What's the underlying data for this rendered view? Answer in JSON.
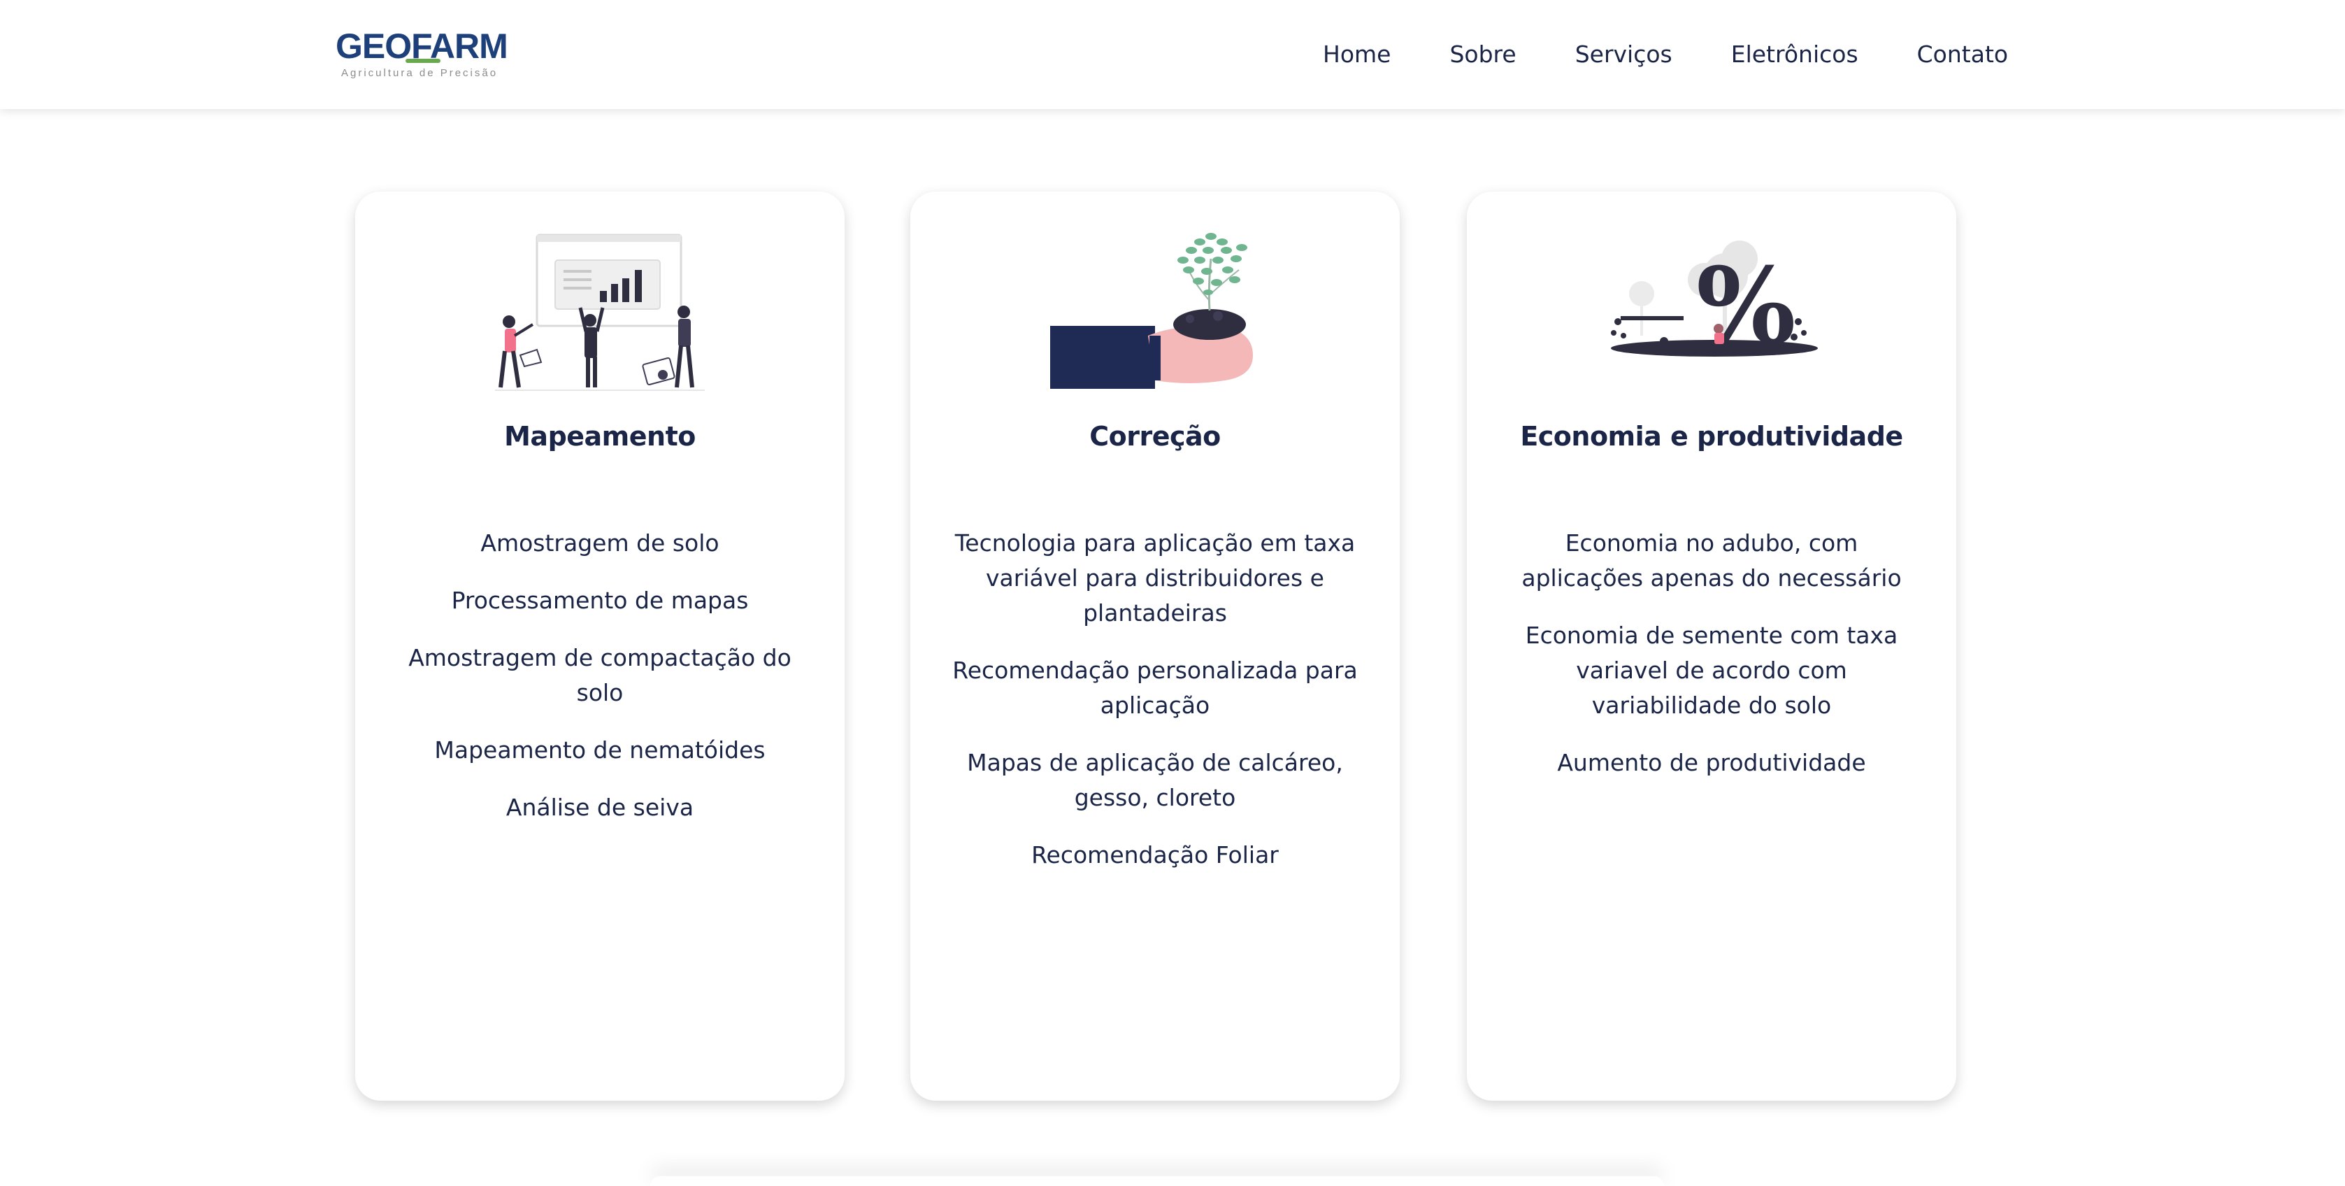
{
  "brand": {
    "name": "GEOFARM",
    "tagline": "Agricultura de Precisão",
    "colors": {
      "primary": "#1d3f7a",
      "accent": "#6aa84f",
      "text": "#1b2547"
    }
  },
  "nav": {
    "items": [
      {
        "label": "Home"
      },
      {
        "label": "Sobre"
      },
      {
        "label": "Serviços"
      },
      {
        "label": "Eletrônicos"
      },
      {
        "label": "Contato"
      }
    ]
  },
  "cards": [
    {
      "icon": "data-analysis-illustration",
      "title": "Mapeamento",
      "items": [
        "Amostragem de solo",
        "Processamento de mapas",
        "Amostragem de compactação do solo",
        "Mapeamento de nematóides",
        "Análise de seiva"
      ]
    },
    {
      "icon": "plant-in-hand-illustration",
      "title": "Correção",
      "items": [
        "Tecnologia para aplicação em taxa variável para distribuidores e plantadeiras",
        "Recomendação personalizada para aplicação",
        "Mapas de aplicação de calcáreo, gesso, cloreto",
        "Recomendação Foliar"
      ]
    },
    {
      "icon": "percent-savings-illustration",
      "title": "Economia e produtividade",
      "items": [
        "Economia no adubo, com aplicações apenas do necessário",
        "Economia de semente com taxa variavel de acordo com variabilidade do solo",
        "Aumento de produtividade"
      ]
    }
  ]
}
